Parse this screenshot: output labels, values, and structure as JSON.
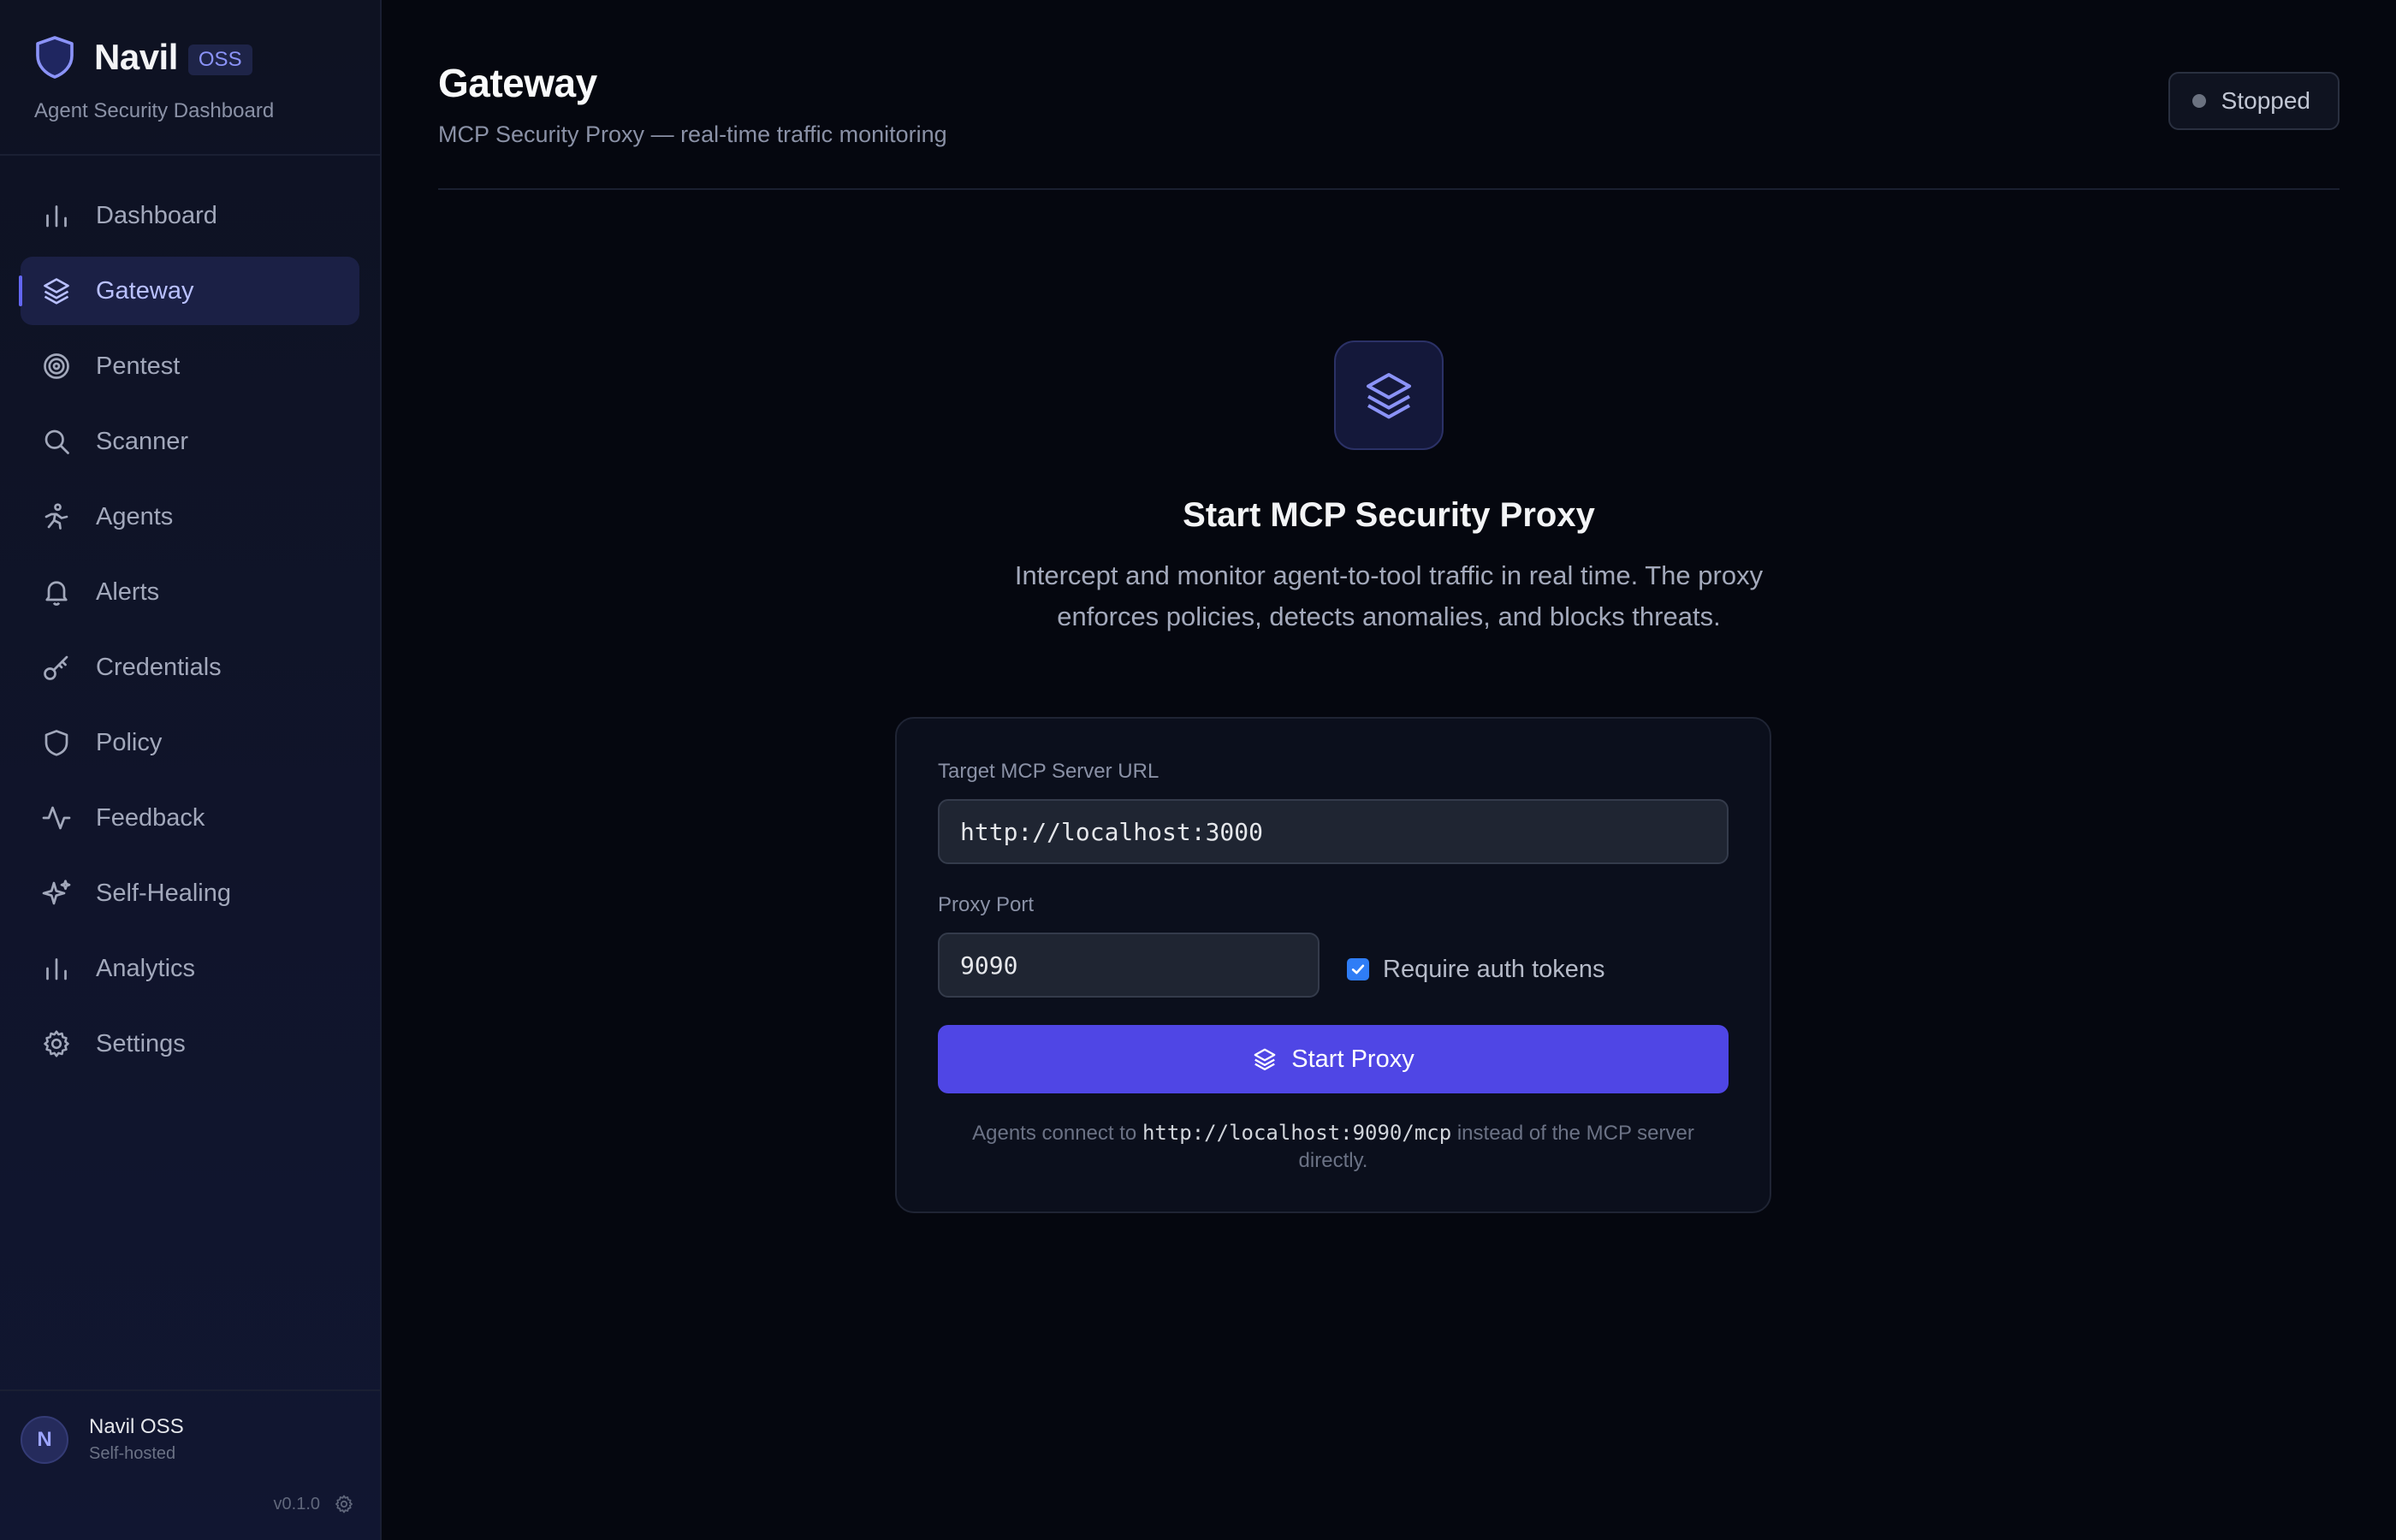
{
  "brand": {
    "name": "Navil",
    "badge": "OSS",
    "subtitle": "Agent Security Dashboard"
  },
  "nav": {
    "items": [
      {
        "label": "Dashboard",
        "icon": "bar-chart-icon",
        "active": false
      },
      {
        "label": "Gateway",
        "icon": "layers-icon",
        "active": true
      },
      {
        "label": "Pentest",
        "icon": "target-icon",
        "active": false
      },
      {
        "label": "Scanner",
        "icon": "search-icon",
        "active": false
      },
      {
        "label": "Agents",
        "icon": "person-running-icon",
        "active": false
      },
      {
        "label": "Alerts",
        "icon": "bell-icon",
        "active": false
      },
      {
        "label": "Credentials",
        "icon": "key-icon",
        "active": false
      },
      {
        "label": "Policy",
        "icon": "shield-icon",
        "active": false
      },
      {
        "label": "Feedback",
        "icon": "activity-icon",
        "active": false
      },
      {
        "label": "Self-Healing",
        "icon": "sparkles-icon",
        "active": false
      },
      {
        "label": "Analytics",
        "icon": "bar-chart-icon",
        "active": false
      },
      {
        "label": "Settings",
        "icon": "gear-icon",
        "active": false
      }
    ]
  },
  "user": {
    "initial": "N",
    "name": "Navil OSS",
    "subtitle": "Self-hosted"
  },
  "version": "v0.1.0",
  "header": {
    "title": "Gateway",
    "subtitle": "MCP Security Proxy — real-time traffic monitoring",
    "status": "Stopped"
  },
  "hero": {
    "title": "Start MCP Security Proxy",
    "description": "Intercept and monitor agent-to-tool traffic in real time. The proxy enforces policies, detects anomalies, and blocks threats."
  },
  "form": {
    "url_label": "Target MCP Server URL",
    "url_value": "http://localhost:3000",
    "port_label": "Proxy Port",
    "port_value": "9090",
    "auth_label": "Require auth tokens",
    "auth_checked": true,
    "start_label": "Start Proxy",
    "hint_prefix": "Agents connect to",
    "hint_code": "http://localhost:9090/mcp",
    "hint_suffix": "instead of the MCP server directly."
  },
  "colors": {
    "accent": "#4f46e5",
    "active_nav_bg": "#1b2045",
    "status_dot": "#6b7280",
    "checkbox": "#2f7df6"
  }
}
